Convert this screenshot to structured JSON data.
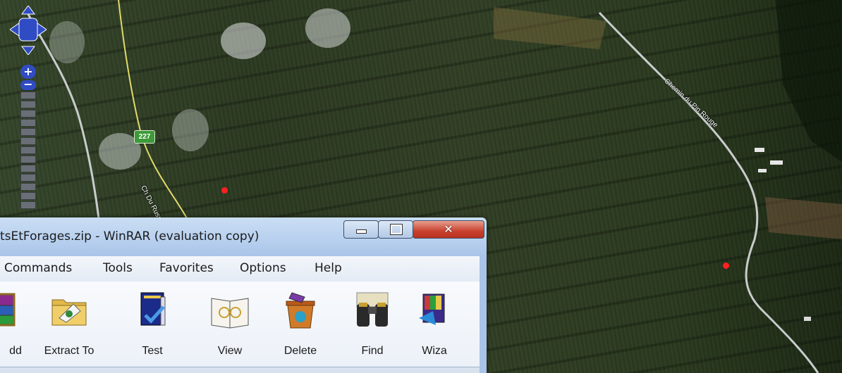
{
  "map": {
    "road_labels": {
      "chemin_pin_rouge": "Chemin du Pin Rouge",
      "ch_du_russeau": "Ch Du Russeau"
    },
    "route_shield": "227",
    "controls": {
      "zoom_in": "+",
      "zoom_out": "−"
    }
  },
  "window": {
    "title": "tsEtForages.zip - WinRAR (evaluation copy)",
    "menu": [
      "Commands",
      "Tools",
      "Favorites",
      "Options",
      "Help"
    ],
    "toolbar": [
      "dd",
      "Extract To",
      "Test",
      "View",
      "Delete",
      "Find",
      "Wiza"
    ],
    "overflow": "»"
  },
  "colors": {
    "marker": "#ff2020",
    "close_button": "#c9402e",
    "route_shield": "#3e9a3a"
  }
}
